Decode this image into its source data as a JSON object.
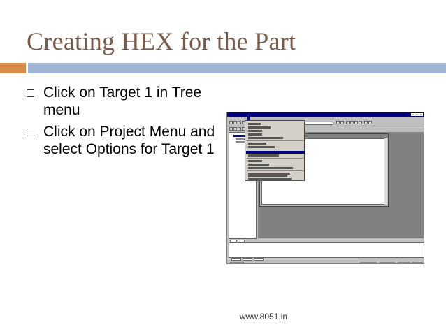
{
  "slide": {
    "title": "Creating HEX for the Part",
    "bullets": [
      "Click on Target 1 in Tree menu",
      "Click on Project Menu and select Options for Target 1"
    ],
    "footer": "www.8051.in"
  },
  "colors": {
    "title": "#7a5a48",
    "accent_orange": "#d98b4a",
    "accent_blue": "#9fb5d3",
    "titlebar": "#000080"
  },
  "screenshot": {
    "alt": "uVision IDE with Project menu open and Options for Target 1 highlighted"
  }
}
